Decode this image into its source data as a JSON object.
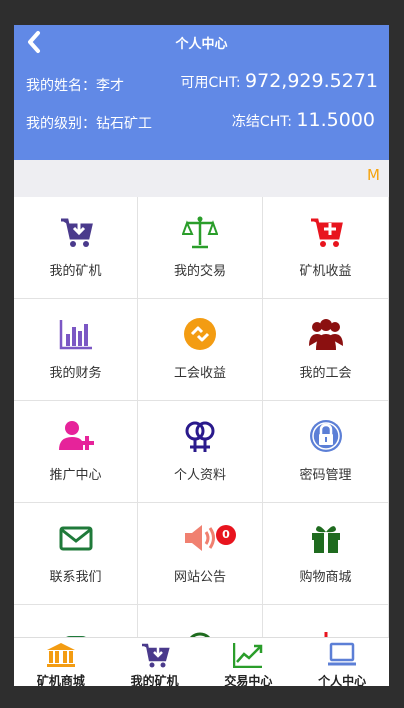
{
  "header": {
    "title": "个人中心",
    "name_label": "我的姓名：",
    "name": "李才",
    "level_label": "我的级别：",
    "level": "钻石矿工",
    "available_label": "可用CHT:",
    "available_value": "972,929.5271",
    "frozen_label": "冻结CHT:",
    "frozen_value": "11.5000",
    "accent_color": "#6189e6"
  },
  "badge_letter": "M",
  "grid": [
    {
      "label": "我的矿机",
      "icon": "cart-download-icon",
      "color": "#4a3a8c"
    },
    {
      "label": "我的交易",
      "icon": "scales-icon",
      "color": "#2a9d2a"
    },
    {
      "label": "矿机收益",
      "icon": "cart-plus-icon",
      "color": "#e8141e"
    },
    {
      "label": "我的财务",
      "icon": "bar-chart-icon",
      "color": "#7b57c4"
    },
    {
      "label": "工会收益",
      "icon": "exchange-circle-icon",
      "color": "#f39c12"
    },
    {
      "label": "我的工会",
      "icon": "group-icon",
      "color": "#8b1010"
    },
    {
      "label": "推广中心",
      "icon": "user-plus-icon",
      "color": "#e6239a"
    },
    {
      "label": "个人资料",
      "icon": "gender-icon",
      "color": "#2a1a8c"
    },
    {
      "label": "密码管理",
      "icon": "lock-circle-icon",
      "color": "#5c7fd6"
    },
    {
      "label": "联系我们",
      "icon": "envelope-icon",
      "color": "#1f7a3a"
    },
    {
      "label": "网站公告",
      "icon": "speaker-icon",
      "color": "#f08070",
      "badge": "0"
    },
    {
      "label": "购物商城",
      "icon": "gift-icon",
      "color": "#1f6b1f"
    }
  ],
  "tabs": [
    {
      "label": "矿机商城",
      "icon": "bank-icon",
      "color": "#f39c12"
    },
    {
      "label": "我的矿机",
      "icon": "cart-download-icon",
      "color": "#4a3a8c"
    },
    {
      "label": "交易中心",
      "icon": "line-chart-icon",
      "color": "#2a9d2a"
    },
    {
      "label": "个人中心",
      "icon": "laptop-icon",
      "color": "#5c7fd6"
    }
  ]
}
